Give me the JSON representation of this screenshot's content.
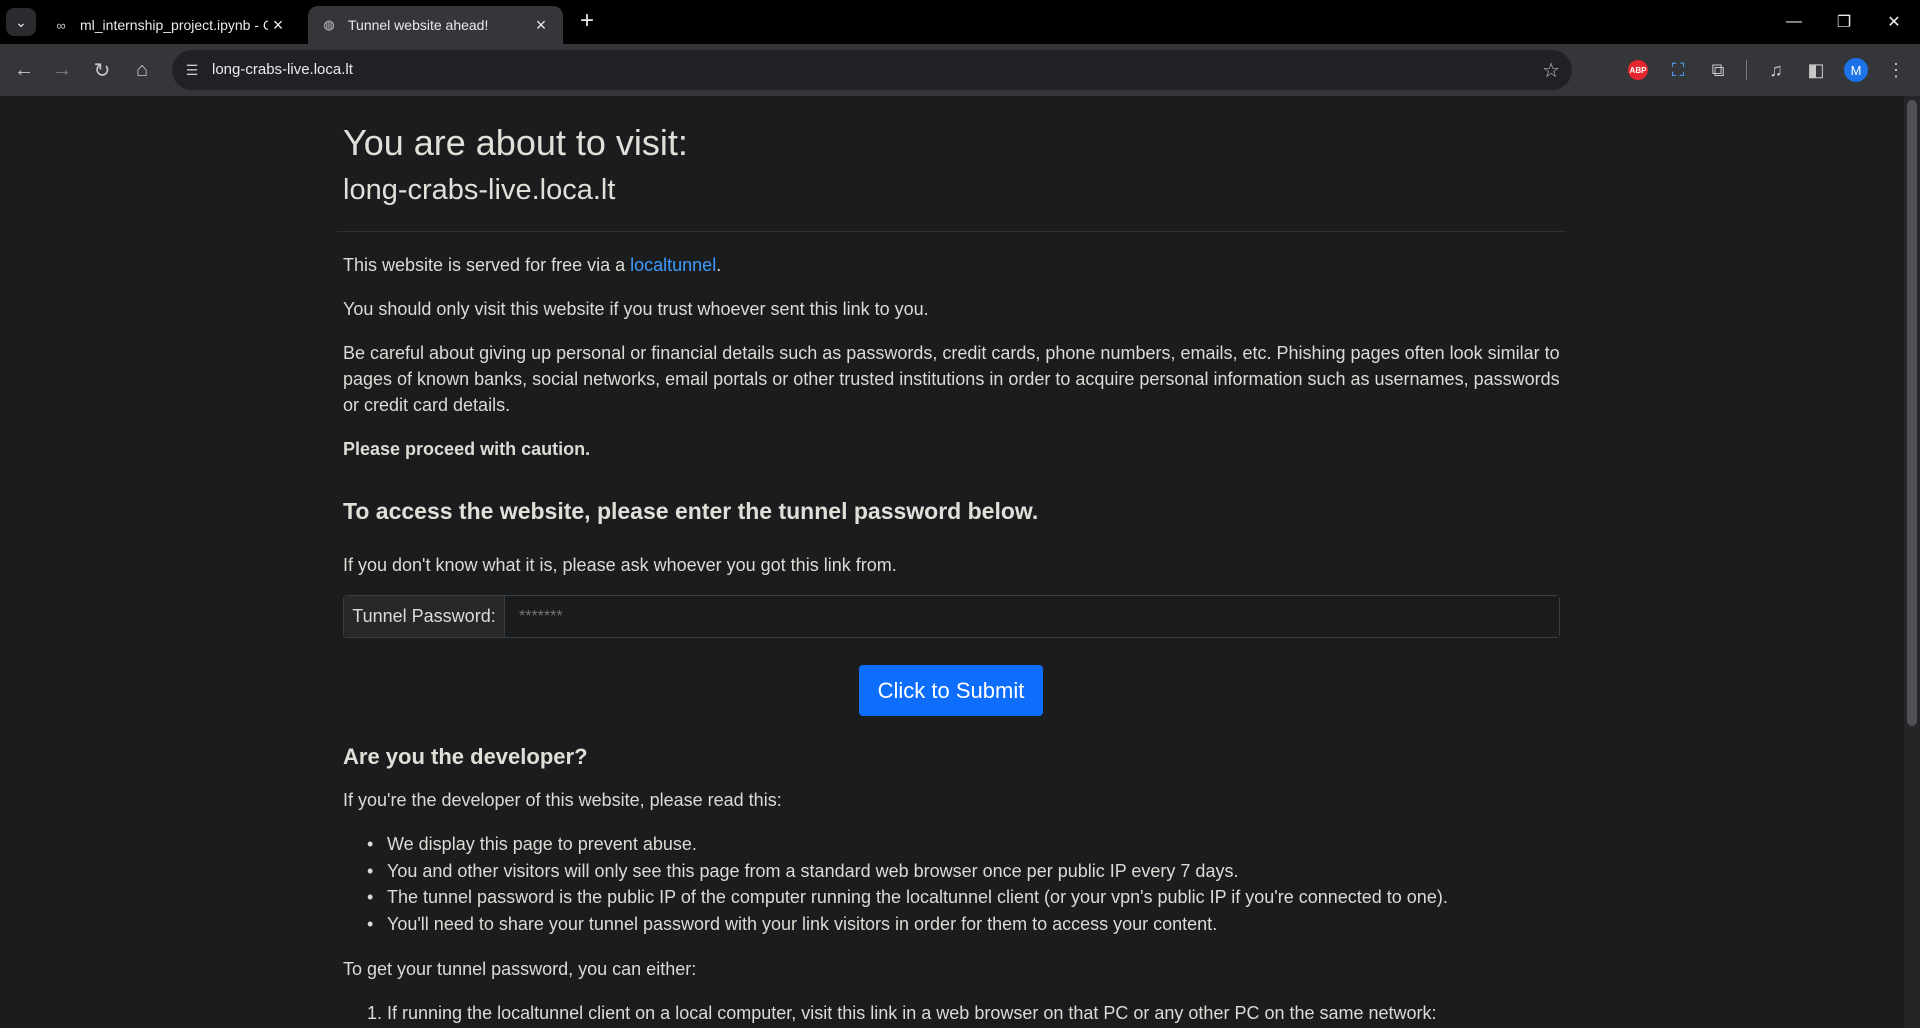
{
  "browser": {
    "tabs": [
      {
        "title": "ml_internship_project.ipynb - Co",
        "icon": "colab-icon"
      },
      {
        "title": "Tunnel website ahead!",
        "icon": "globe-icon",
        "active": true
      }
    ],
    "url": "long-crabs-live.loca.lt",
    "avatar_initial": "M",
    "abp_label": "ABP"
  },
  "page": {
    "heading": "You are about to visit:",
    "host": "long-crabs-live.loca.lt",
    "served_prefix": "This website is served for free via a ",
    "served_link": "localtunnel",
    "served_suffix": ".",
    "trust_text": "You should only visit this website if you trust whoever sent this link to you.",
    "careful_text": "Be careful about giving up personal or financial details such as passwords, credit cards, phone numbers, emails, etc. Phishing pages often look similar to pages of known banks, social networks, email portals or other trusted institutions in order to acquire personal information such as usernames, passwords or credit card details.",
    "caution": "Please proceed with caution.",
    "access_heading": "To access the website, please enter the tunnel password below.",
    "dont_know": "If you don't know what it is, please ask whoever you got this link from.",
    "password_label": "Tunnel Password:",
    "password_placeholder": "*******",
    "submit_label": "Click to Submit",
    "dev_heading": "Are you the developer?",
    "dev_intro": "If you're the developer of this website, please read this:",
    "dev_points": [
      "We display this page to prevent abuse.",
      "You and other visitors will only see this page from a standard web browser once per public IP every 7 days.",
      "The tunnel password is the public IP of the computer running the localtunnel client (or your vpn's public IP if you're connected to one).",
      "You'll need to share your tunnel password with your link visitors in order for them to access your content."
    ],
    "get_password": "To get your tunnel password, you can either:",
    "steps": [
      {
        "num": "1.",
        "text": "If running the localtunnel client on a local computer, visit this link in a web browser on that PC or any other PC on the same network:"
      }
    ]
  }
}
